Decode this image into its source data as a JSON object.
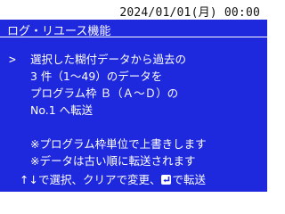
{
  "clock": "2024/01/01(月) 00:00",
  "title": "ログ・リユース機能",
  "cursor": ">",
  "message": {
    "line1": "選択した糊付データから過去の",
    "line2": "3 件（1～49）のデータを",
    "line3": "プログラム枠 Ｂ（Ａ～Ｄ）の",
    "line4": "No.1 へ転送"
  },
  "notes": {
    "note1": "※プログラム枠単位で上書きします",
    "note2": "※データは古い順に転送されます"
  },
  "footer": {
    "part1": "↑↓で選択、クリアで変更、",
    "part2": "で転送"
  },
  "colors": {
    "panel_bg": "#1e28dc",
    "text": "#ffffff"
  },
  "icons": {
    "enter": "enter-key-icon"
  }
}
